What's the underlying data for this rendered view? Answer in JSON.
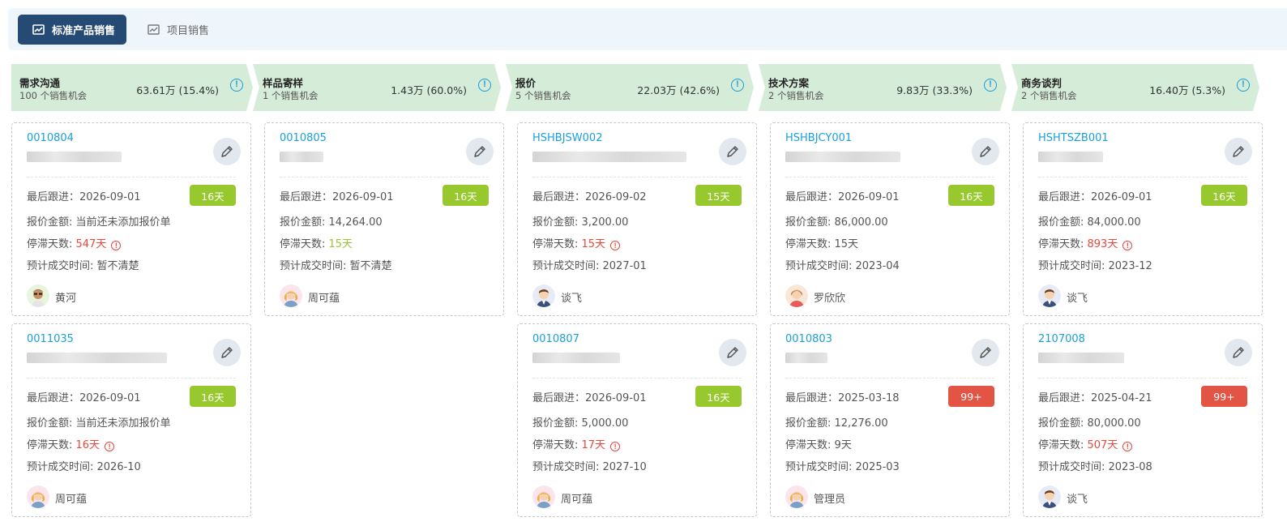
{
  "tabs": [
    {
      "label": "标准产品销售",
      "active": true
    },
    {
      "label": "项目销售",
      "active": false
    }
  ],
  "colors": {
    "accent": "#254a73",
    "link": "#1b9fd9",
    "stage_bg": "#d5ecd9",
    "badge_ok": "#97c92e",
    "badge_overdue": "#e25444",
    "alert": "#e8473a"
  },
  "labels": {
    "last_follow": "最后跟进：",
    "quote_amount": "报价金额: ",
    "stagnant_days": "停滞天数: ",
    "expected_close": "预计成交时间: "
  },
  "stages": [
    {
      "name": "需求沟通",
      "count": "100 个销售机会",
      "amount": "63.61万 (15.4%)",
      "cards": [
        {
          "code": "0010804",
          "last_follow": "2026-09-01",
          "badge": "16天",
          "badge_type": "g",
          "quote": "当前还未添加报价单",
          "stagnant": "547天",
          "stagnant_type": "red",
          "stagnant_alert": true,
          "expected": "暂不清楚",
          "owner": "黄河",
          "avatar": "male-dark"
        },
        {
          "code": "0011035",
          "last_follow": "2026-09-01",
          "badge": "16天",
          "badge_type": "g",
          "quote": "当前还未添加报价单",
          "stagnant": "16天",
          "stagnant_type": "red",
          "stagnant_alert": true,
          "expected": "2026-10",
          "owner": "周可蕴",
          "avatar": "female"
        }
      ]
    },
    {
      "name": "样品寄样",
      "count": "1 个销售机会",
      "amount": "1.43万 (60.0%)",
      "cards": [
        {
          "code": "0010805",
          "last_follow": "2026-09-01",
          "badge": "16天",
          "badge_type": "g",
          "quote": "14,264.00",
          "stagnant": "15天",
          "stagnant_type": "green",
          "stagnant_alert": false,
          "expected": "暂不清楚",
          "owner": "周可蕴",
          "avatar": "female"
        }
      ]
    },
    {
      "name": "报价",
      "count": "5 个销售机会",
      "amount": "22.03万 (42.6%)",
      "cards": [
        {
          "code": "HSHBJSW002",
          "last_follow": "2026-09-02",
          "badge": "15天",
          "badge_type": "g",
          "quote": "3,200.00",
          "stagnant": "15天",
          "stagnant_type": "red",
          "stagnant_alert": true,
          "expected": "2027-01",
          "owner": "谈飞",
          "avatar": "male-suit"
        },
        {
          "code": "0010807",
          "last_follow": "2026-09-01",
          "badge": "16天",
          "badge_type": "g",
          "quote": "5,000.00",
          "stagnant": "17天",
          "stagnant_type": "red",
          "stagnant_alert": true,
          "expected": "2027-10",
          "owner": "周可蕴",
          "avatar": "female"
        }
      ]
    },
    {
      "name": "技术方案",
      "count": "2 个销售机会",
      "amount": "9.83万 (33.3%)",
      "cards": [
        {
          "code": "HSHBJCY001",
          "last_follow": "2026-09-01",
          "badge": "16天",
          "badge_type": "g",
          "quote": "86,000.00",
          "stagnant": "15天",
          "stagnant_type": "plain",
          "stagnant_alert": false,
          "expected": "2023-04",
          "owner": "罗欣欣",
          "avatar": "female-red"
        },
        {
          "code": "0010803",
          "last_follow": "2025-03-18",
          "badge": "99+",
          "badge_type": "r",
          "quote": "12,276.00",
          "stagnant": "9天",
          "stagnant_type": "plain",
          "stagnant_alert": false,
          "expected": "2025-03",
          "owner": "管理员",
          "avatar": "female"
        }
      ]
    },
    {
      "name": "商务谈判",
      "count": "2 个销售机会",
      "amount": "16.40万 (5.3%)",
      "cards": [
        {
          "code": "HSHTSZB001",
          "last_follow": "2026-09-01",
          "badge": "16天",
          "badge_type": "g",
          "quote": "84,000.00",
          "stagnant": "893天",
          "stagnant_type": "red",
          "stagnant_alert": true,
          "expected": "2023-12",
          "owner": "谈飞",
          "avatar": "male-suit"
        },
        {
          "code": "2107008",
          "last_follow": "2025-04-21",
          "badge": "99+",
          "badge_type": "r",
          "quote": "80,000.00",
          "stagnant": "507天",
          "stagnant_type": "red",
          "stagnant_alert": true,
          "expected": "2023-08",
          "owner": "谈飞",
          "avatar": "male-suit"
        }
      ]
    }
  ]
}
